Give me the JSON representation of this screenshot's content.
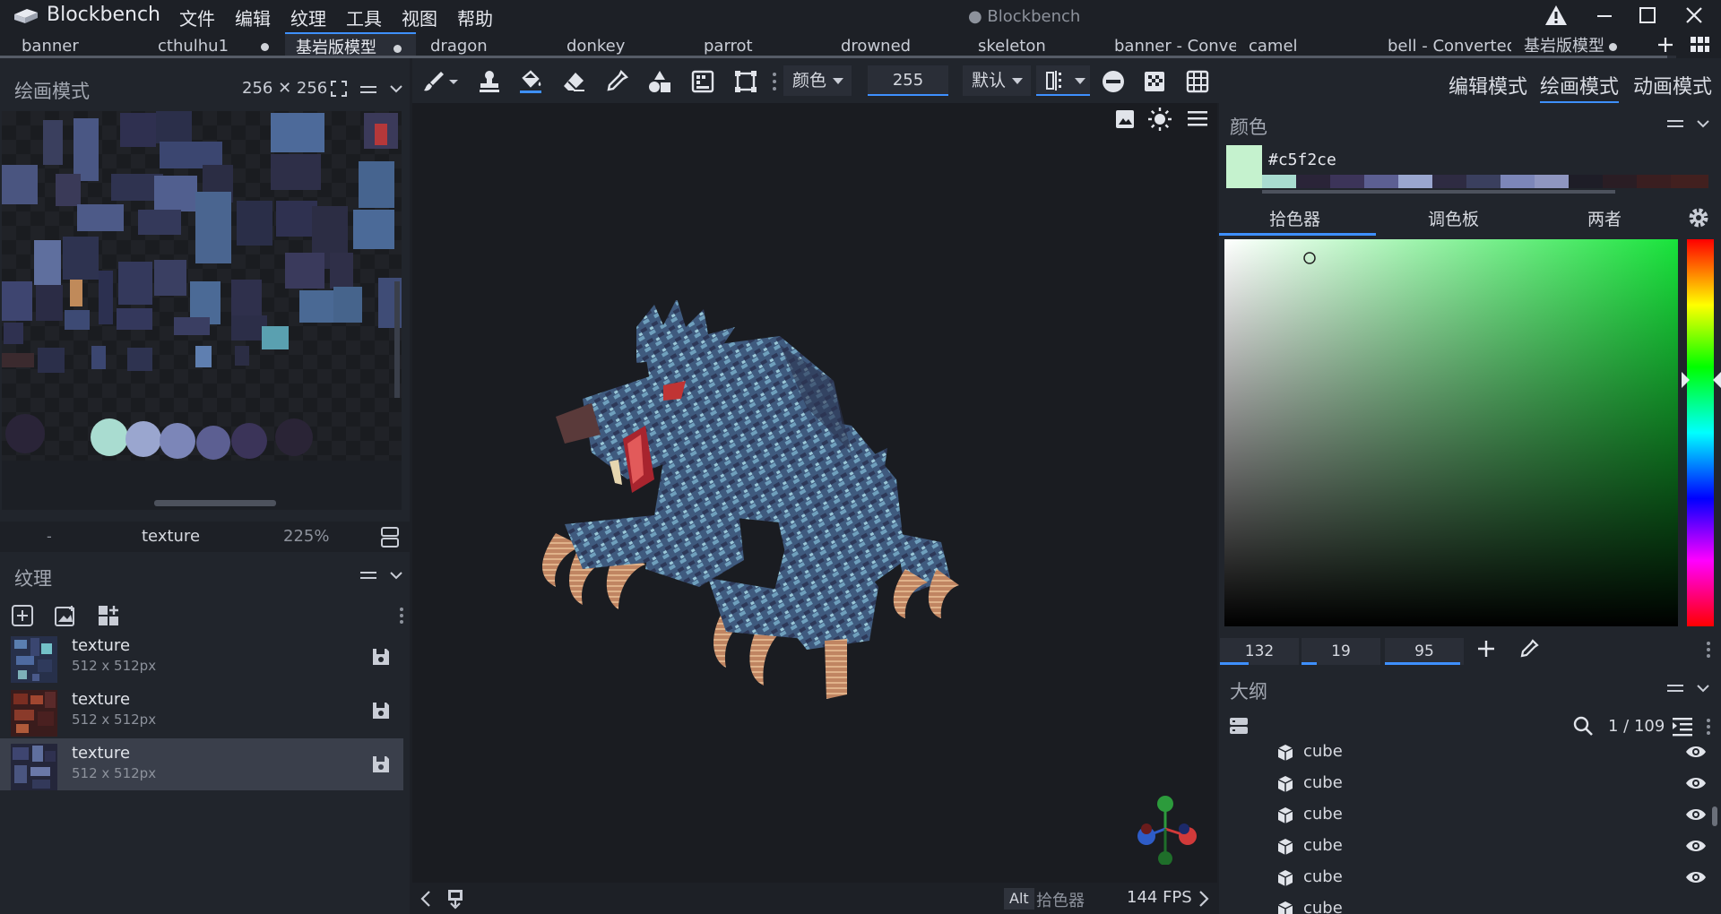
{
  "app": {
    "name": "Blockbench",
    "window_title": "● Blockbench",
    "menu": [
      "文件",
      "编辑",
      "纹理",
      "工具",
      "视图",
      "帮助"
    ]
  },
  "tabs": [
    {
      "label": "banner",
      "active": false,
      "unsaved": false
    },
    {
      "label": "cthulhu1",
      "active": false,
      "unsaved": true
    },
    {
      "label": "基岩版模型",
      "active": true,
      "unsaved": true
    },
    {
      "label": "dragon",
      "active": false,
      "unsaved": false
    },
    {
      "label": "donkey",
      "active": false,
      "unsaved": false
    },
    {
      "label": "parrot",
      "active": false,
      "unsaved": false
    },
    {
      "label": "drowned",
      "active": false,
      "unsaved": false
    },
    {
      "label": "skeleton",
      "active": false,
      "unsaved": false
    },
    {
      "label": "banner - Conver",
      "active": false,
      "unsaved": false
    },
    {
      "label": "camel",
      "active": false,
      "unsaved": false
    },
    {
      "label": "bell - Converted",
      "active": false,
      "unsaved": false
    },
    {
      "label": "基岩版模型",
      "active": false,
      "unsaved": true
    }
  ],
  "paint_panel": {
    "title": "绘画模式",
    "resolution": "256 ✕ 256",
    "footer_dash": "-",
    "texture_name": "texture",
    "zoom": "225%"
  },
  "textures_panel": {
    "title": "纹理",
    "items": [
      {
        "name": "texture",
        "size": "512 x 512px",
        "selected": false
      },
      {
        "name": "texture",
        "size": "512 x 512px",
        "selected": false
      },
      {
        "name": "texture",
        "size": "512 x 512px",
        "selected": true
      }
    ]
  },
  "toolbar": {
    "color_mode": "颜色",
    "opacity": "255",
    "blend_mode": "默认"
  },
  "modes": {
    "edit": "编辑模式",
    "paint": "绘画模式",
    "animate": "动画模式",
    "active": "paint"
  },
  "viewport": {
    "statusbar": {
      "key_hint": "Alt",
      "key_action": "拾色器",
      "fps": "144 FPS"
    }
  },
  "color_panel": {
    "title": "颜色",
    "hex": "#c5f2ce",
    "swatch_color": "#c5f2ce",
    "tabs": [
      "拾色器",
      "调色板",
      "两者"
    ],
    "active_tab": 0,
    "hsv": [
      "132",
      "19",
      "95"
    ]
  },
  "outliner": {
    "title": "大纲",
    "count": "1 / 109",
    "items": [
      "cube",
      "cube",
      "cube",
      "cube",
      "cube",
      "cube"
    ]
  },
  "colors": {
    "accent": "#3e90ff",
    "bg": "#1d2026"
  }
}
